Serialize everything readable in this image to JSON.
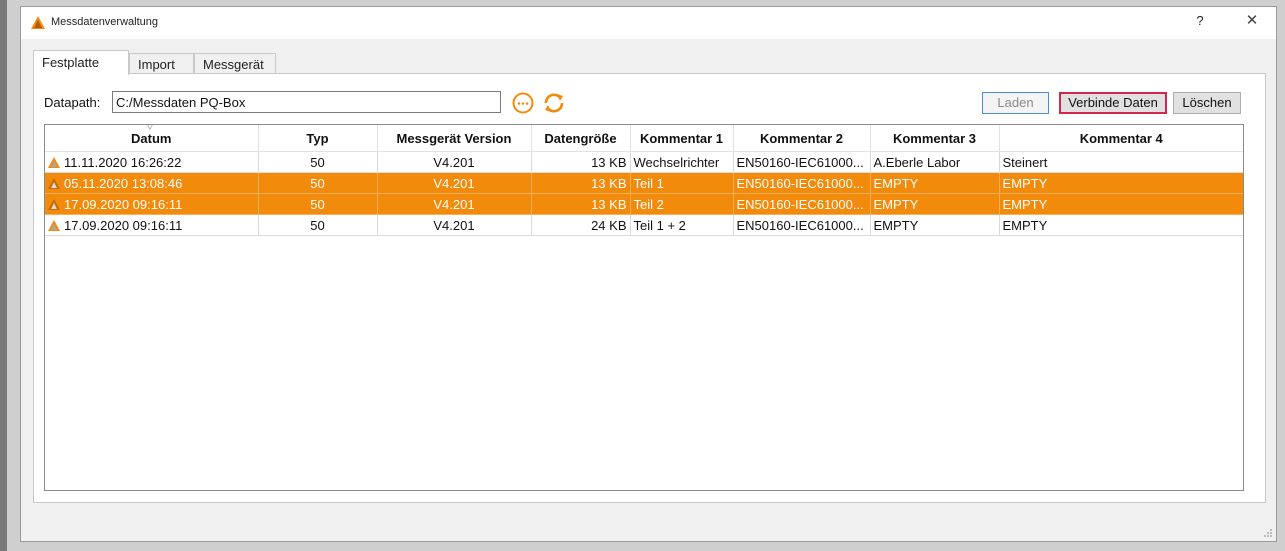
{
  "window": {
    "title": "Messdatenverwaltung",
    "help": "?",
    "close": "✕"
  },
  "tabs": [
    {
      "label": "Festplatte",
      "active": true
    },
    {
      "label": "Import",
      "active": false
    },
    {
      "label": "Messgerät",
      "active": false
    }
  ],
  "datapath": {
    "label": "Datapath:",
    "value": "C:/Messdaten PQ-Box"
  },
  "icons": {
    "browse": "ellipsis-circle-icon",
    "refresh": "refresh-icon",
    "app": "app-logo-icon",
    "row": "measurement-file-icon"
  },
  "buttons": {
    "laden": "Laden",
    "verbinde": "Verbinde Daten",
    "loeschen": "Löschen"
  },
  "colors": {
    "selection": "#f28a0c",
    "accent_icon": "#f28a0c",
    "highlight_border": "#d6264e",
    "focus_border": "#4a90d9"
  },
  "table": {
    "columns": [
      "Datum",
      "Typ",
      "Messgerät Version",
      "Datengröße",
      "Kommentar 1",
      "Kommentar 2",
      "Kommentar 3",
      "Kommentar 4"
    ],
    "rows": [
      {
        "cells": [
          "11.11.2020 16:26:22",
          "50",
          "V4.201",
          "13 KB",
          "Wechselrichter",
          "EN50160-IEC61000...",
          "A.Eberle Labor",
          "Steinert"
        ],
        "selected": false
      },
      {
        "cells": [
          "05.11.2020 13:08:46",
          "50",
          "V4.201",
          "13 KB",
          "Teil 1",
          "EN50160-IEC61000...",
          "EMPTY",
          "EMPTY"
        ],
        "selected": true
      },
      {
        "cells": [
          "17.09.2020 09:16:11",
          "50",
          "V4.201",
          "13 KB",
          "Teil 2",
          "EN50160-IEC61000...",
          "EMPTY",
          "EMPTY"
        ],
        "selected": true
      },
      {
        "cells": [
          "17.09.2020 09:16:11",
          "50",
          "V4.201",
          "24 KB",
          "Teil 1 + 2",
          "EN50160-IEC61000...",
          "EMPTY",
          "EMPTY"
        ],
        "selected": false
      }
    ]
  }
}
